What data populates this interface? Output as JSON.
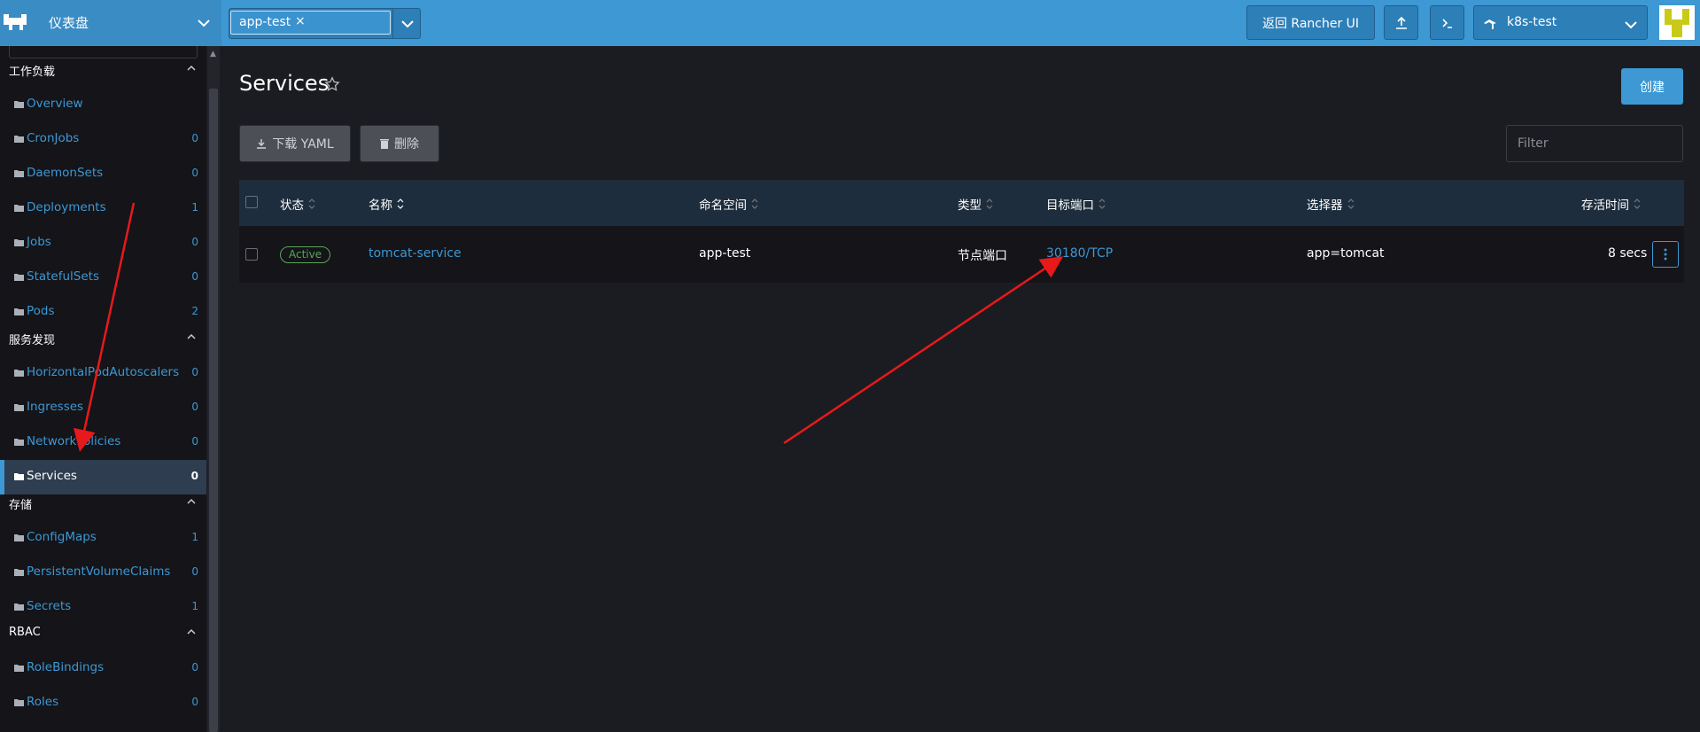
{
  "header": {
    "brand_title": "仪表盘",
    "namespace_filter": "app-test",
    "back_button": "返回 Rancher UI",
    "cluster_name": "k8s-test",
    "icons": [
      "rancher-logo-icon",
      "chevron-down-icon",
      "upload-icon",
      "terminal-icon",
      "cluster-icon"
    ]
  },
  "sidebar": {
    "groups": [
      {
        "label": "工作负载",
        "items": [
          {
            "label": "Overview",
            "count": ""
          },
          {
            "label": "CronJobs",
            "count": "0"
          },
          {
            "label": "DaemonSets",
            "count": "0"
          },
          {
            "label": "Deployments",
            "count": "1"
          },
          {
            "label": "Jobs",
            "count": "0"
          },
          {
            "label": "StatefulSets",
            "count": "0"
          },
          {
            "label": "Pods",
            "count": "2"
          }
        ]
      },
      {
        "label": "服务发现",
        "items": [
          {
            "label": "HorizontalPodAutoscalers",
            "count": "0"
          },
          {
            "label": "Ingresses",
            "count": "0"
          },
          {
            "label": "NetworkPolicies",
            "count": "0"
          },
          {
            "label": "Services",
            "count": "0",
            "active": true
          }
        ]
      },
      {
        "label": "存储",
        "items": [
          {
            "label": "ConfigMaps",
            "count": "1"
          },
          {
            "label": "PersistentVolumeClaims",
            "count": "0"
          },
          {
            "label": "Secrets",
            "count": "1"
          }
        ]
      },
      {
        "label": "RBAC",
        "items": [
          {
            "label": "RoleBindings",
            "count": "0"
          },
          {
            "label": "Roles",
            "count": "0"
          }
        ]
      }
    ]
  },
  "main": {
    "title": "Services",
    "create_button": "创建",
    "download_yaml_button": "下载 YAML",
    "delete_button": "删除",
    "filter_placeholder": "Filter",
    "columns": [
      "状态",
      "名称",
      "命名空间",
      "类型",
      "目标端口",
      "选择器",
      "存活时间"
    ],
    "rows": [
      {
        "state": "Active",
        "name": "tomcat-service",
        "namespace": "app-test",
        "type": "节点端口",
        "target_port": "30180/TCP",
        "selector": "app=tomcat",
        "age": "8 secs"
      }
    ]
  },
  "colors": {
    "accent": "#3d98d3",
    "topbar": "#3d98d3",
    "active_badge": "#5aa55a",
    "annotation_arrow": "#e8191b"
  }
}
